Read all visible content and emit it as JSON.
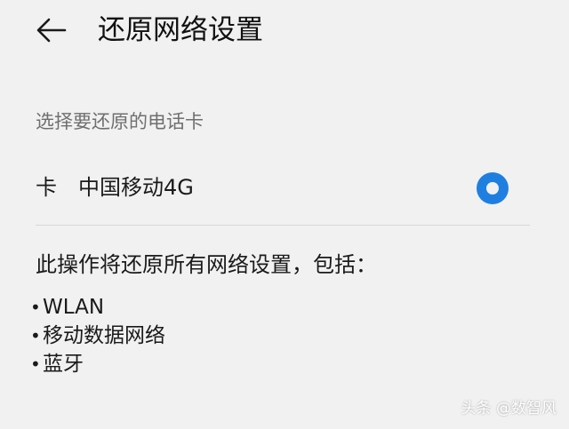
{
  "header": {
    "title": "还原网络设置",
    "back_icon": "arrow-left-icon"
  },
  "section": {
    "label": "选择要还原的电话卡"
  },
  "sim": {
    "prefix": "卡",
    "name": "中国移动4G",
    "selected": true,
    "accent": "#1f7fe0"
  },
  "description": "此操作将还原所有网络设置，包括：",
  "items": [
    "WLAN",
    "移动数据网络",
    "蓝牙"
  ],
  "bullet": "•",
  "watermark": "头条 @数智风"
}
